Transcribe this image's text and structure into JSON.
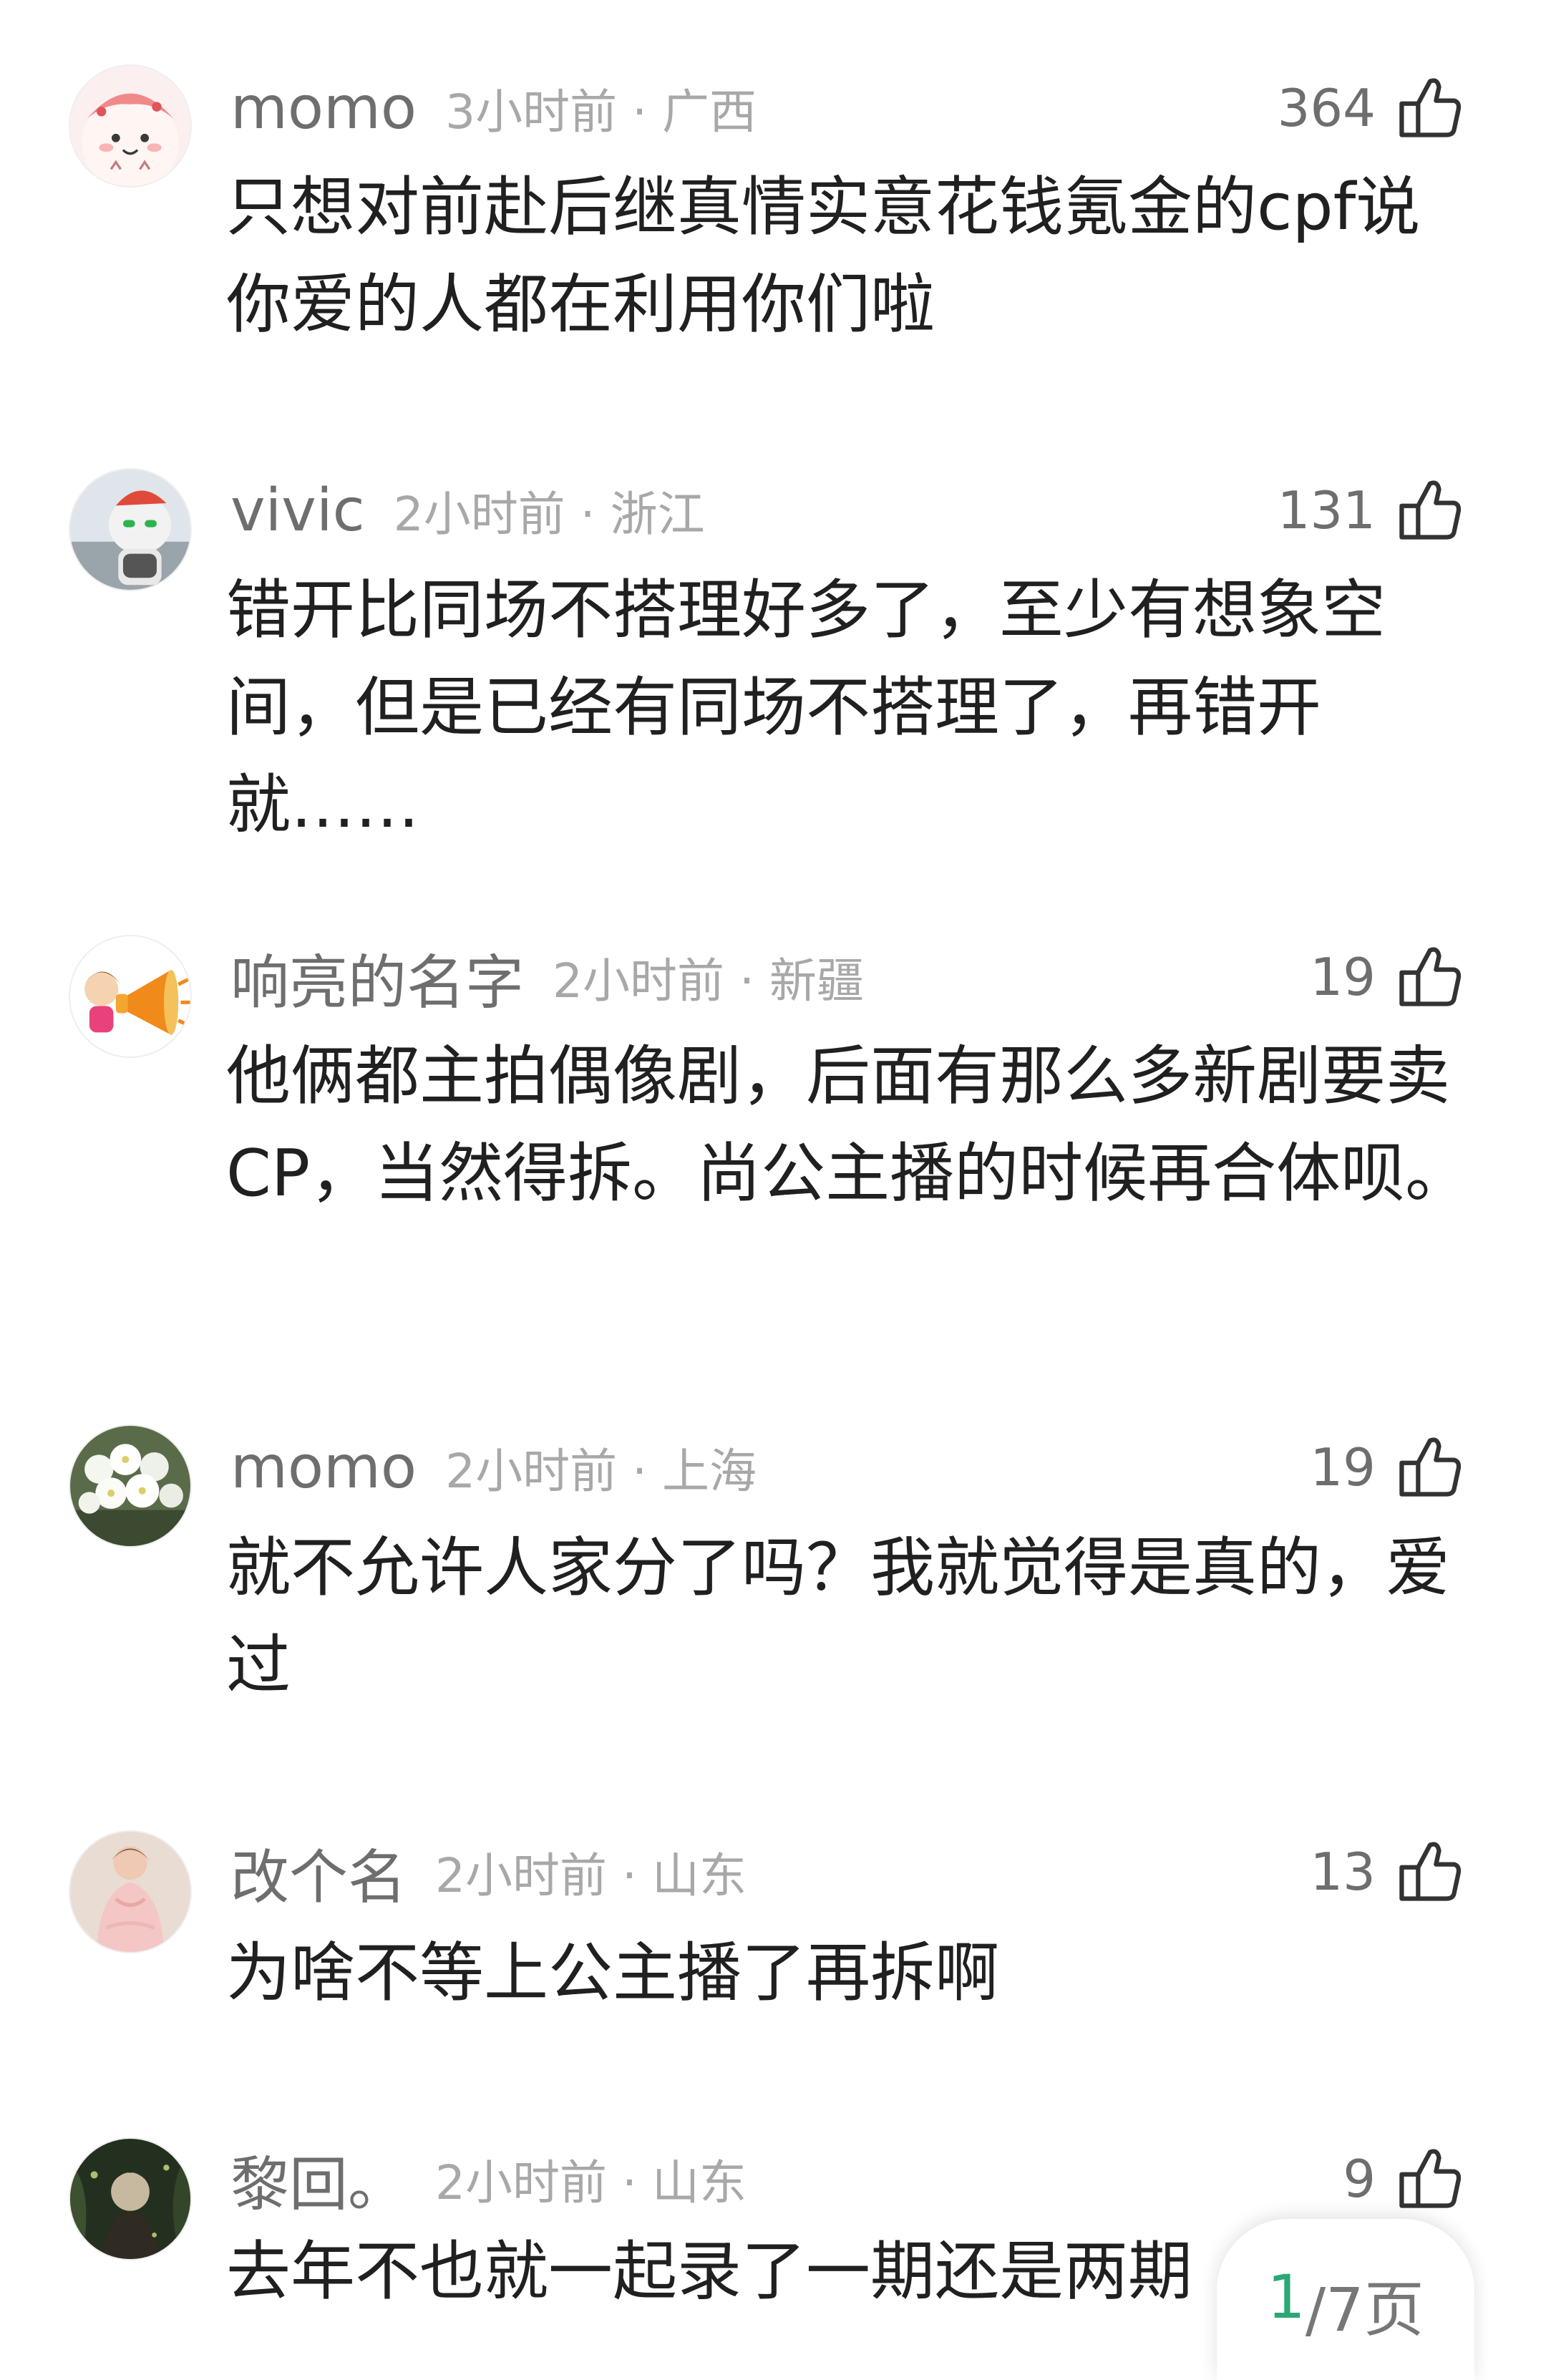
{
  "comments": [
    {
      "username": "momo",
      "time_location": "3小时前 · 广西",
      "likes": "364",
      "text": "只想对前赴后继真情实意花钱氪金的cpf说你爱的人都在利用你们啦",
      "avatar": "pink-cartoon-avatar"
    },
    {
      "username": "vivic",
      "time_location": "2小时前 · 浙江",
      "likes": "131",
      "text": "错开比同场不搭理好多了，至少有想象空间，但是已经有同场不搭理了，再错开就……",
      "avatar": "robot-avatar"
    },
    {
      "username": "响亮的名字",
      "time_location": "2小时前 · 新疆",
      "likes": "19",
      "text": "他俩都主拍偶像剧，后面有那么多新剧要卖CP，当然得拆。尚公主播的时候再合体呗。",
      "avatar": "megaphone-girl-avatar"
    },
    {
      "username": "momo",
      "time_location": "2小时前 · 上海",
      "likes": "19",
      "text": "就不允许人家分了吗？我就觉得是真的，爱过",
      "avatar": "white-flowers-avatar"
    },
    {
      "username": "改个名",
      "time_location": "2小时前 · 山东",
      "likes": "13",
      "text": "为啥不等上公主播了再拆啊",
      "avatar": "pink-outfit-avatar"
    },
    {
      "username": "黎回。",
      "time_location": "2小时前 · 山东",
      "likes": "9",
      "text": "去年不也就一起录了一期还是两期",
      "avatar": "dark-forest-avatar"
    }
  ],
  "pager": {
    "current": "1",
    "total_label": "/7页"
  },
  "colors": {
    "username": "#6e6e6e",
    "meta": "#a8a8a8",
    "text": "#202020",
    "pager_accent": "#2aa876"
  },
  "icons": {
    "like": "thumbs-up-outline-icon"
  }
}
